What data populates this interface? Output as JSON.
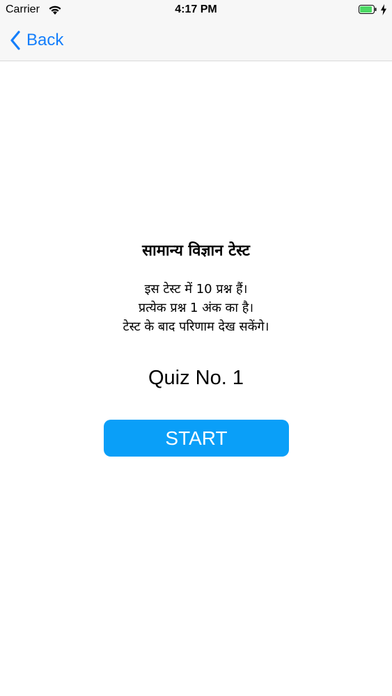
{
  "status_bar": {
    "carrier": "Carrier",
    "time": "4:17 PM",
    "icons": [
      "wifi-icon",
      "battery-icon",
      "charging-bolt-icon"
    ],
    "battery_color": "#4cd964"
  },
  "nav": {
    "back_label": "Back",
    "back_icon": "chevron-left-icon",
    "accent_color": "#147efb"
  },
  "quiz": {
    "title": "सामान्य विज्ञान टेस्ट",
    "instructions": [
      "इस टेस्ट में 10 प्रश्न हैं।",
      "प्रत्येक प्रश्न 1 अंक का है।",
      "टेस्ट के बाद परिणाम देख सकेंगे।"
    ],
    "number_label": "Quiz No. 1",
    "start_label": "START",
    "start_color": "#0a9ff8"
  }
}
